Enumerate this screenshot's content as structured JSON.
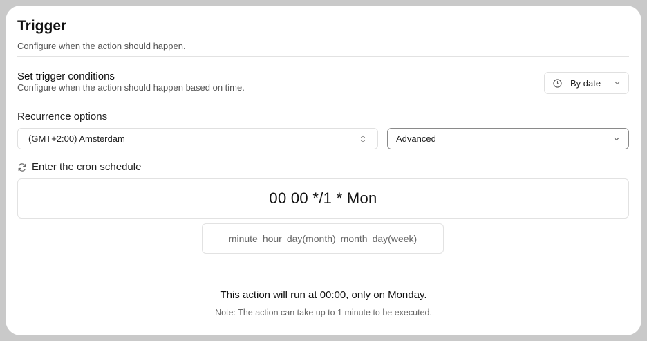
{
  "header": {
    "title": "Trigger",
    "subtitle": "Configure when the action should happen."
  },
  "conditions": {
    "title": "Set trigger conditions",
    "subtitle": "Configure when the action should happen based on time.",
    "mode_button": {
      "label": "By date",
      "icon": "clock-icon"
    }
  },
  "recurrence": {
    "label": "Recurrence options",
    "timezone": {
      "value": "(GMT+2:00) Amsterdam",
      "icon": "chevron-up-down-icon"
    },
    "mode": {
      "value": "Advanced",
      "icon": "chevron-down-icon"
    }
  },
  "cron": {
    "label": "Enter the cron schedule",
    "icon": "refresh-icon",
    "expression": "00 00 */1 * Mon",
    "fields": [
      "minute",
      "hour",
      "day(month)",
      "month",
      "day(week)"
    ]
  },
  "summary": {
    "text": "This action will run at 00:00, only on Monday.",
    "note": "Note: The action can take up to 1 minute to be executed."
  }
}
